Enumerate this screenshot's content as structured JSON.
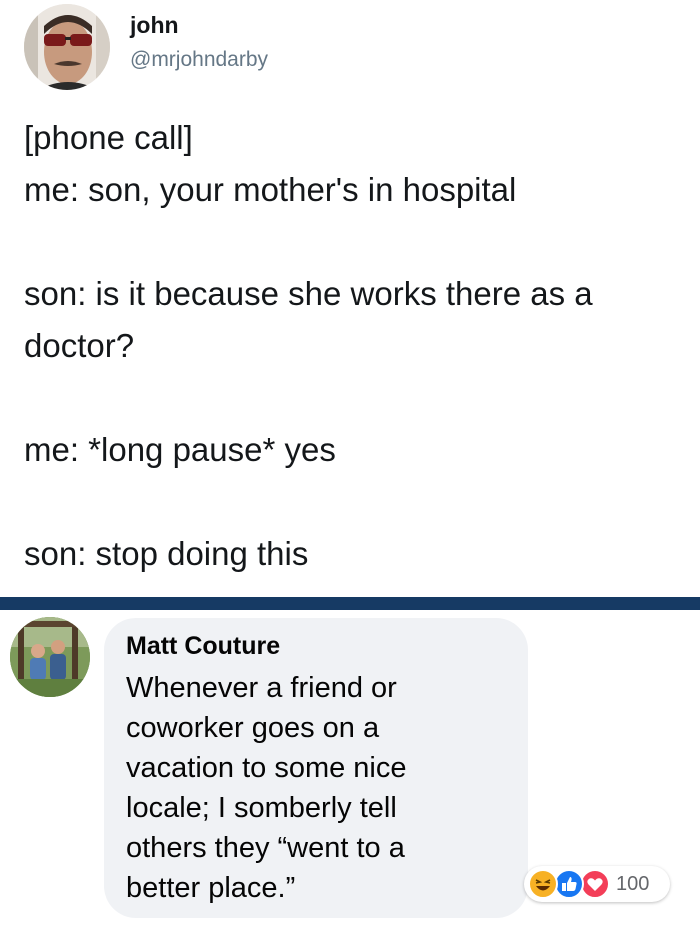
{
  "tweet": {
    "author_name": "john",
    "author_handle": "@mrjohndarby",
    "lines": [
      "[phone call]",
      "me: son, your mother's in hospital",
      "",
      "son: is it because she works there as a",
      "doctor?",
      "",
      "me: *long pause* yes",
      "",
      "son: stop doing this"
    ]
  },
  "comment": {
    "author_name": "Matt Couture",
    "lines": [
      "Whenever a friend or",
      "coworker goes on a",
      "vacation to some nice",
      "locale; I somberly tell",
      "others they “went to a",
      "better place.”"
    ],
    "reactions": {
      "icons": [
        "haha-icon",
        "like-icon",
        "love-icon"
      ],
      "count": "100"
    }
  },
  "colors": {
    "divider": "#163a64",
    "bubble": "#f0f2f5",
    "handle": "#657786"
  }
}
